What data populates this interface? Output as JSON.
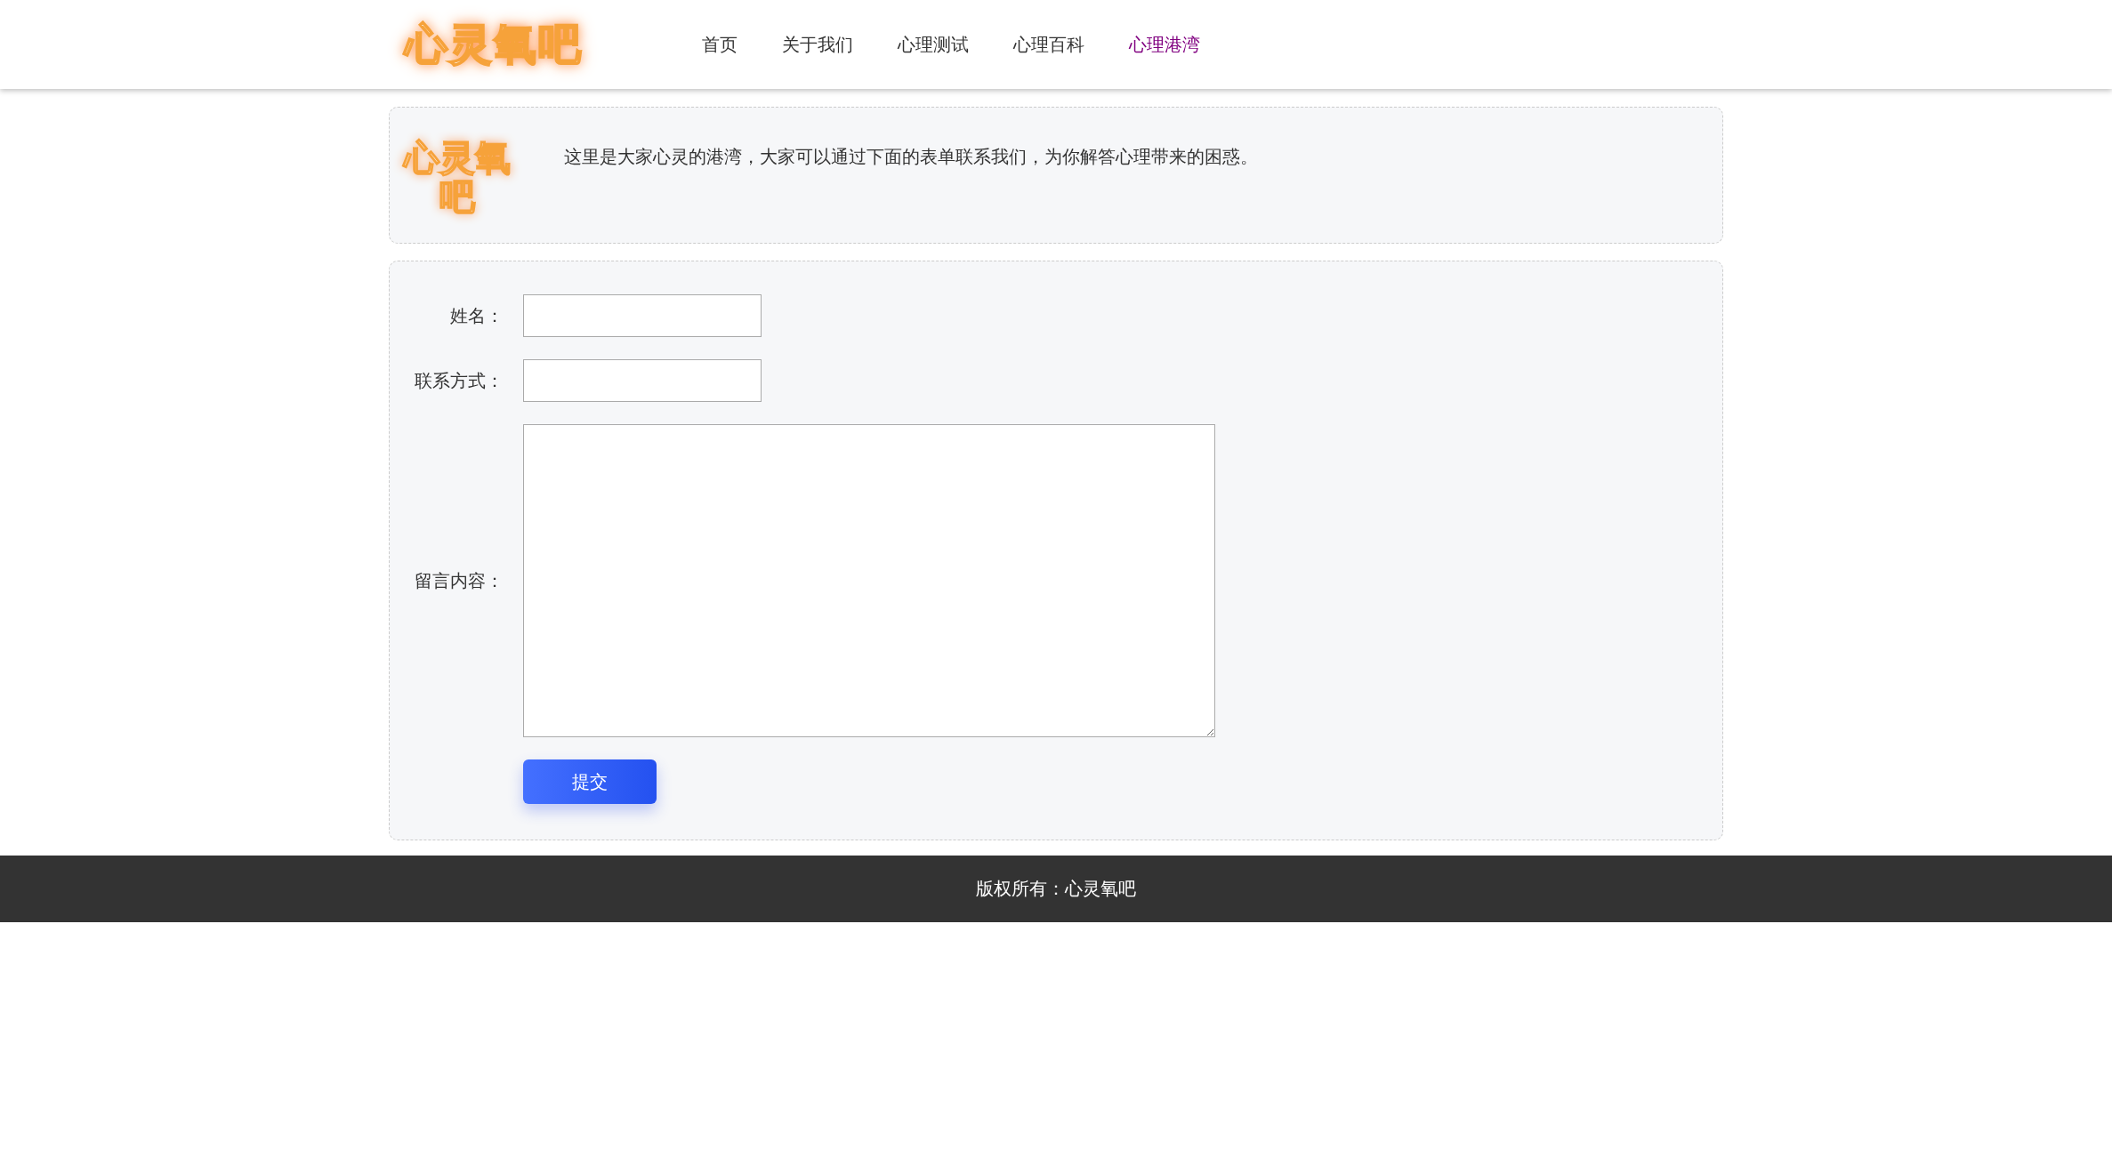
{
  "header": {
    "logo": "心灵氧吧",
    "nav": [
      {
        "label": "首页",
        "selected": false
      },
      {
        "label": "关于我们",
        "selected": false
      },
      {
        "label": "心理测试",
        "selected": false
      },
      {
        "label": "心理百科",
        "selected": false
      },
      {
        "label": "心理港湾",
        "selected": true
      }
    ]
  },
  "intro": {
    "logo": "心灵氧吧",
    "text": "这里是大家心灵的港湾，大家可以通过下面的表单联系我们，为你解答心理带来的困惑。"
  },
  "form": {
    "fields": [
      {
        "label": "姓名：",
        "kind": "text"
      },
      {
        "label": "联系方式：",
        "kind": "text"
      },
      {
        "label": "留言内容：",
        "kind": "textarea"
      }
    ],
    "submit": "提交"
  },
  "footer": {
    "text": "版权所有：心灵氧吧"
  }
}
